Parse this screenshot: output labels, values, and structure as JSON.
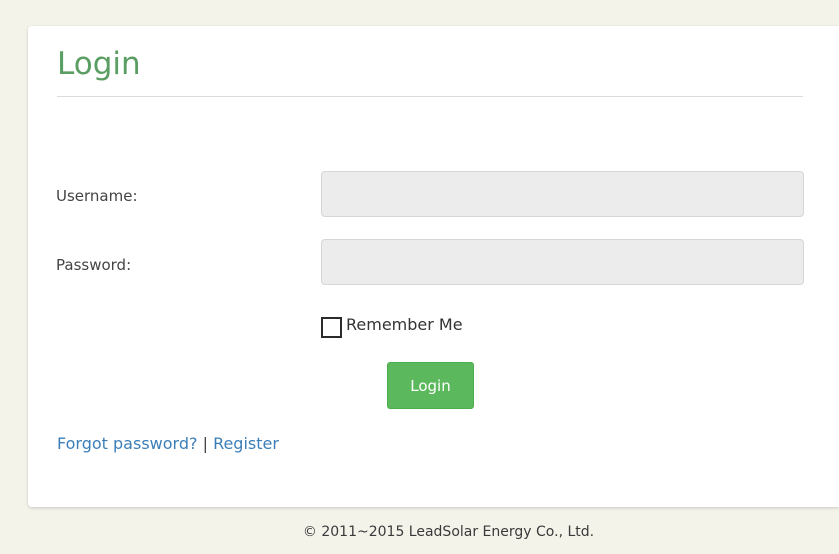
{
  "login_panel": {
    "title": "Login",
    "username": {
      "label": "Username:",
      "value": "",
      "placeholder": ""
    },
    "password": {
      "label": "Password:",
      "value": "",
      "placeholder": ""
    },
    "remember_me": {
      "label": "Remember Me",
      "checked": false
    },
    "submit_label": "Login",
    "links": {
      "forgot_password": "Forgot password?",
      "separator": "|",
      "register": "Register"
    }
  },
  "footer": {
    "copyright": "© 2011~2015 LeadSolar Energy Co., Ltd."
  },
  "colors": {
    "page_background": "#f4f3ea",
    "title": "#5a9e63",
    "button": "#5cb85c",
    "link": "#3c7fb8",
    "input_background": "#ececec"
  }
}
